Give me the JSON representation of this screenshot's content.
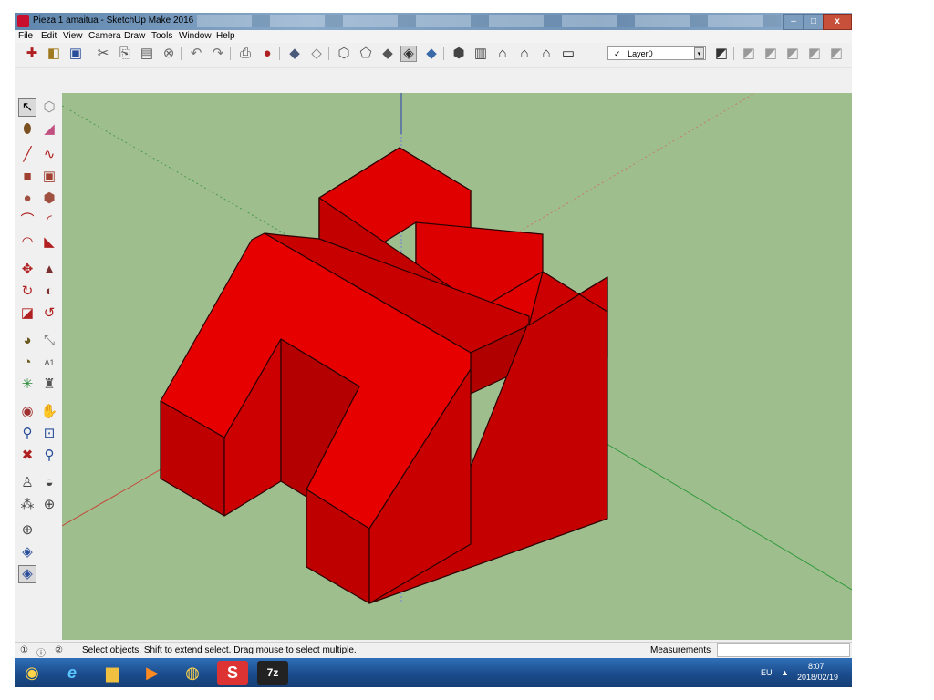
{
  "window": {
    "title": "Pieza 1 amaitua - SketchUp Make 2016",
    "controls": {
      "minimize": "–",
      "maximize": "□",
      "close": "x"
    }
  },
  "menu": [
    "File",
    "Edit",
    "View",
    "Camera",
    "Draw",
    "Tools",
    "Window",
    "Help"
  ],
  "toolbar": {
    "layer": {
      "check": "✓",
      "value": "Layer0",
      "dropdown_glyph": "▾"
    }
  },
  "statusbar": {
    "icons": [
      "①",
      "ⓘ",
      "②"
    ],
    "message": "Select objects. Shift to extend select. Drag mouse to select multiple.",
    "measurements_label": "Measurements",
    "measurements_value": ""
  },
  "taskbar": {
    "items": [
      {
        "name": "start-button",
        "glyph": "◉"
      },
      {
        "name": "internet-explorer",
        "glyph": "e"
      },
      {
        "name": "file-explorer",
        "glyph": "▆"
      },
      {
        "name": "media-player",
        "glyph": "▶"
      },
      {
        "name": "chrome",
        "glyph": "◍"
      },
      {
        "name": "sketchup",
        "glyph": "S"
      },
      {
        "name": "7zip",
        "glyph": "7z"
      }
    ],
    "language": "EU",
    "tray_arrow": "▲",
    "time": "8:07",
    "date": "2018/02/19"
  },
  "colors": {
    "model_top": "#e60000",
    "model_left": "#bf0000",
    "model_right": "#cc0000",
    "ground": "#9fbe8e",
    "axis_red": "#c44a3a",
    "axis_green": "#2f9a3a",
    "axis_blue": "#2a3fb0"
  }
}
